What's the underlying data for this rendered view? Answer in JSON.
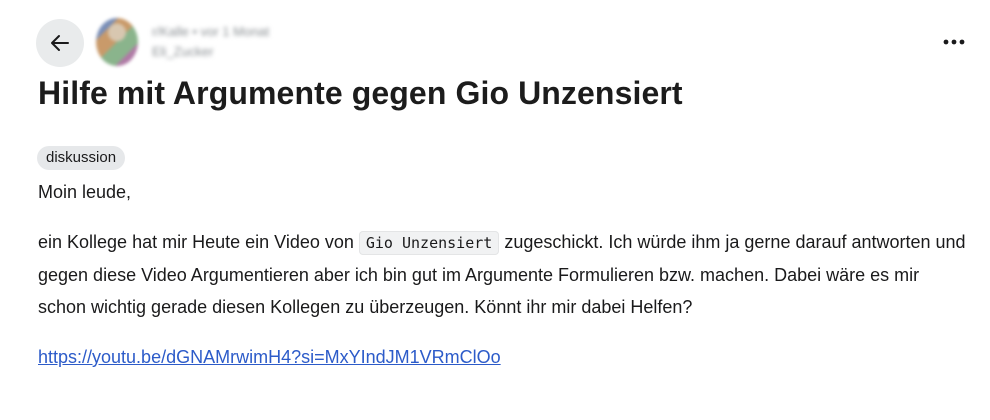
{
  "header": {
    "meta_line_1": "r/Kalle • vor 1 Monat",
    "meta_line_2": "Eli_Zucker",
    "more_label": "•••"
  },
  "post": {
    "title": "Hilfe mit Argumente gegen Gio Unzensiert",
    "flair": "diskussion",
    "greeting": "Moin leude,",
    "body_before_code": "ein Kollege hat mir Heute ein Video von ",
    "body_code": "Gio Unzensiert",
    "body_after_code": " zugeschickt. Ich würde ihm ja gerne darauf antworten und gegen diese Video Argumentieren aber ich bin gut im Argumente Formulieren bzw. machen. Dabei wäre es mir schon wichtig gerade diesen Kollegen zu überzeugen. Könnt ihr mir dabei Helfen?",
    "link": "https://youtu.be/dGNAMrwimH4?si=MxYIndJM1VRmClOo"
  }
}
